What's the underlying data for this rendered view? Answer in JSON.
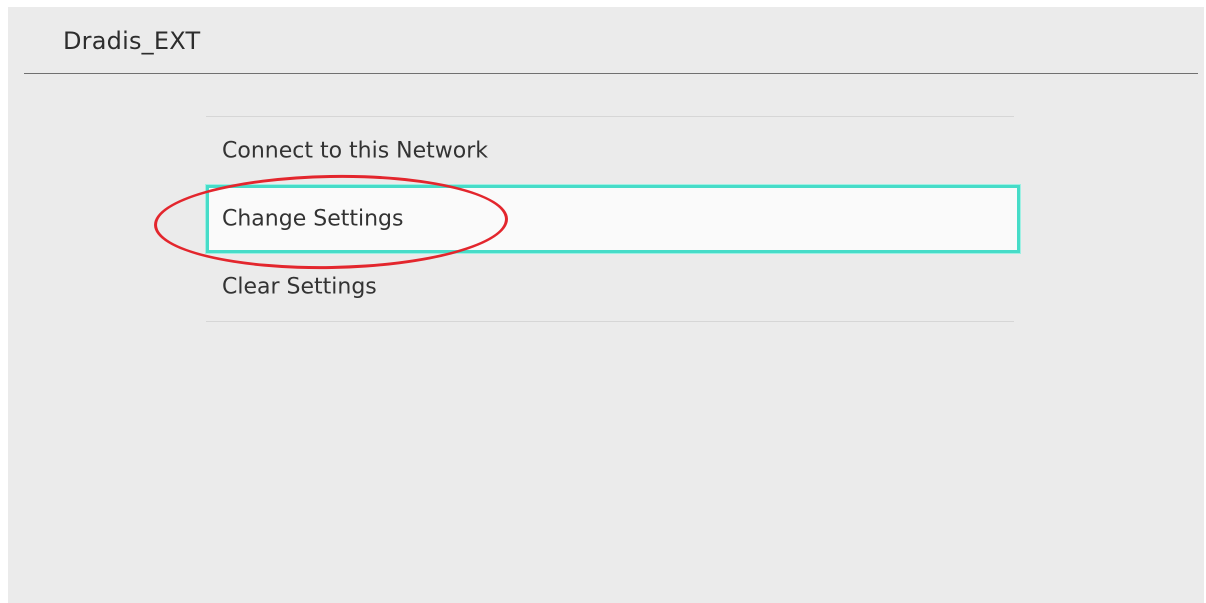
{
  "header": {
    "title": "Dradis_EXT"
  },
  "menu": {
    "items": [
      {
        "label": "Connect to this Network",
        "selected": false
      },
      {
        "label": "Change Settings",
        "selected": true
      },
      {
        "label": "Clear Settings",
        "selected": false
      }
    ]
  },
  "colors": {
    "background": "#ebebeb",
    "selection_border": "#46dcc8",
    "annotation": "#e3262d",
    "text": "#333333"
  }
}
